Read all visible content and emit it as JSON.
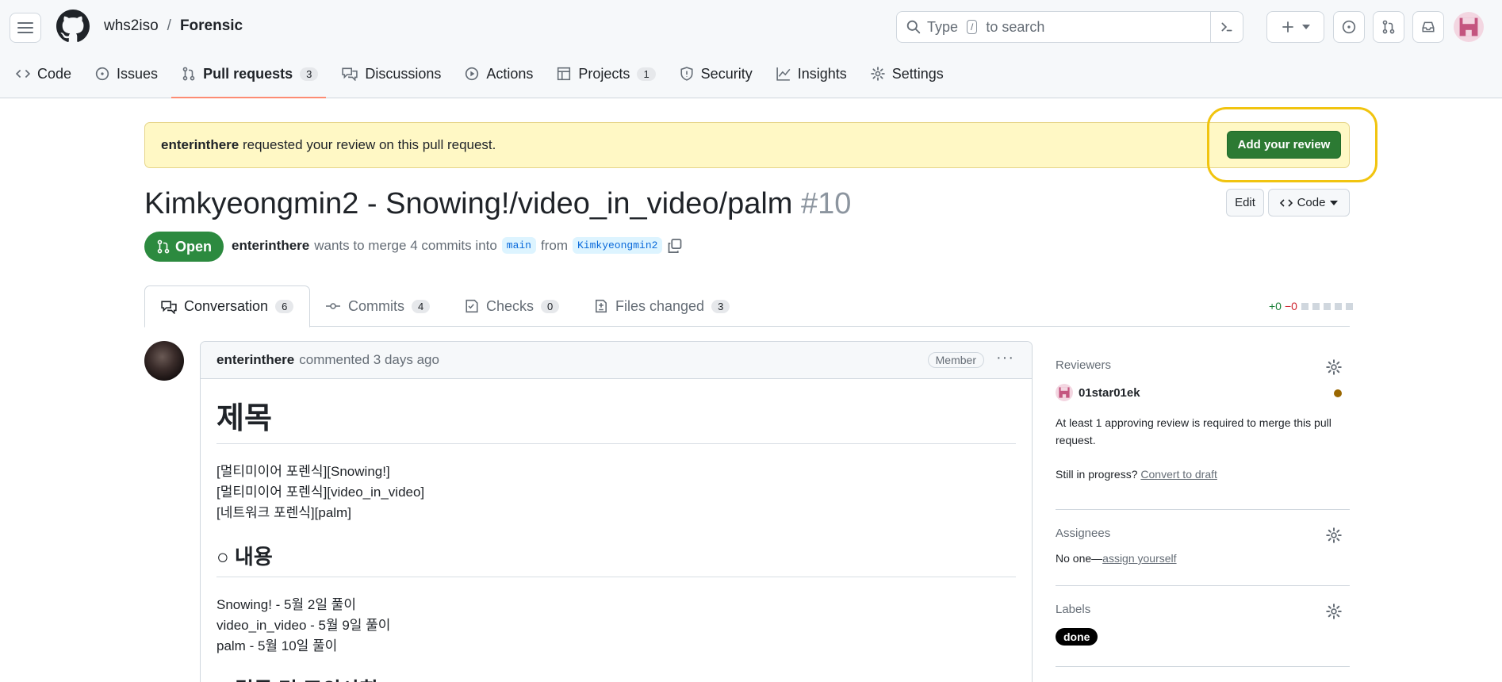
{
  "header": {
    "owner": "whs2iso",
    "separator": "/",
    "repo": "Forensic",
    "search": {
      "prefix": "Type",
      "key": "/",
      "suffix": "to search"
    }
  },
  "nav": [
    {
      "label": "Code",
      "icon": "code-icon"
    },
    {
      "label": "Issues",
      "icon": "issue-icon"
    },
    {
      "label": "Pull requests",
      "icon": "pull-request-icon",
      "count": "3",
      "active": true
    },
    {
      "label": "Discussions",
      "icon": "discussion-icon"
    },
    {
      "label": "Actions",
      "icon": "play-icon"
    },
    {
      "label": "Projects",
      "icon": "table-icon",
      "count": "1"
    },
    {
      "label": "Security",
      "icon": "shield-icon"
    },
    {
      "label": "Insights",
      "icon": "graph-icon"
    },
    {
      "label": "Settings",
      "icon": "gear-icon"
    }
  ],
  "banner": {
    "user": "enterinthere",
    "text": "requested your review on this pull request.",
    "button": "Add your review"
  },
  "pr": {
    "title": "Kimkyeongmin2 - Snowing!/video_in_video/palm",
    "number": "#10",
    "edit": "Edit",
    "code": "Code",
    "state": "Open",
    "author": "enterinthere",
    "merge_text": "wants to merge 4 commits into",
    "base": "main",
    "from": "from",
    "head": "Kimkyeongmin2"
  },
  "tabs": [
    {
      "label": "Conversation",
      "count": "6"
    },
    {
      "label": "Commits",
      "count": "4"
    },
    {
      "label": "Checks",
      "count": "0"
    },
    {
      "label": "Files changed",
      "count": "3"
    }
  ],
  "diffstat": {
    "add": "+0",
    "del": "−0"
  },
  "comment": {
    "author": "enterinthere",
    "action": "commented 3 days ago",
    "role": "Member",
    "more": "···",
    "h1": "제목",
    "lines1": [
      "[멀티미이어 포렌식][Snowing!]",
      "[멀티미이어 포렌식][video_in_video]",
      "[네트워크 포렌식][palm]"
    ],
    "h2": "○ 내용",
    "lines2": [
      "Snowing! - 5월 2일 풀이",
      "video_in_video - 5월 9일 풀이",
      "palm - 5월 10일 풀이"
    ],
    "h3": "○ 결론 및 주의사항"
  },
  "sidebar": {
    "reviewers": {
      "title": "Reviewers",
      "name": "01star01ek",
      "note": "At least 1 approving review is required to merge this pull request.",
      "progress_prefix": "Still in progress?",
      "progress_link": "Convert to draft"
    },
    "assignees": {
      "title": "Assignees",
      "none": "No one—",
      "link": "assign yourself"
    },
    "labels": {
      "title": "Labels",
      "label": "done"
    }
  },
  "colors": {
    "accent_green": "#2c7a33",
    "banner_bg": "#fff8c5",
    "highlight": "#f1c40f",
    "underline": "#fd8c73"
  }
}
